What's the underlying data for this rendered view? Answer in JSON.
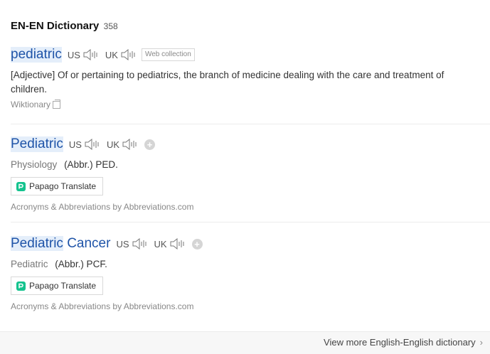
{
  "header": {
    "title": "EN-EN Dictionary",
    "count": "358"
  },
  "entries": [
    {
      "headword": "pediatric",
      "pron_us": "US",
      "pron_uk": "UK",
      "tag": "Web collection",
      "definition": "[Adjective] Of or pertaining to pediatrics, the branch of medicine dealing with the care and treatment of children.",
      "source": "Wiktionary"
    },
    {
      "headword": "Pediatric",
      "pron_us": "US",
      "pron_uk": "UK",
      "field": "Physiology",
      "meaning": "(Abbr.) PED.",
      "papago": "Papago Translate",
      "source": "Acronyms & Abbreviations by Abbreviations.com"
    },
    {
      "headword_hl": "Pediatric",
      "headword_rest": " Cancer",
      "pron_us": "US",
      "pron_uk": "UK",
      "field": "Pediatric",
      "meaning": "(Abbr.) PCF.",
      "papago": "Papago Translate",
      "source": "Acronyms & Abbreviations by Abbreviations.com"
    }
  ],
  "footer": {
    "view_more": "View more English-English dictionary"
  },
  "icons": {
    "speaker": "speaker-icon",
    "plus": "plus-icon",
    "papago": "papago-icon",
    "external": "external-link-icon",
    "chevron": "chevron-right-icon"
  },
  "colors": {
    "headword": "#1f54a8",
    "highlight": "#e4eefa",
    "papago_green": "#14c38e"
  }
}
